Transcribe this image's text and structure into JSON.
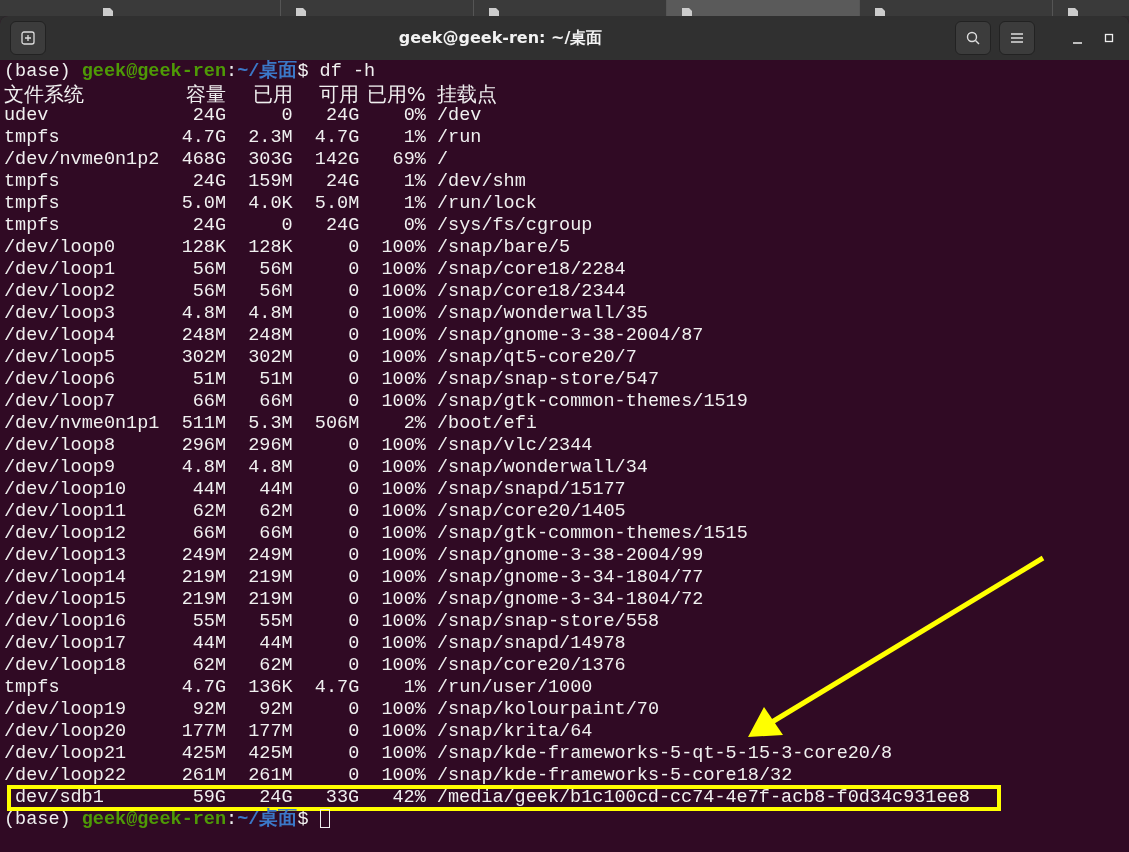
{
  "background_tabs": [
    {
      "selected": false
    },
    {
      "selected": false
    },
    {
      "selected": false
    },
    {
      "selected": true
    },
    {
      "selected": false
    },
    {
      "selected": false
    }
  ],
  "window": {
    "title": "geek@geek-ren: ~/桌面"
  },
  "terminal": {
    "prompt": {
      "env": "(base) ",
      "user_host": "geek@geek-ren",
      "sep": ":",
      "path": "~/桌面",
      "symbol": "$ ",
      "command": "df -h"
    },
    "header": [
      "文件系统",
      "容量",
      "已用",
      "可用",
      "已用%",
      "挂载点"
    ],
    "rows": [
      {
        "text": "udev             24G     0   24G    0% /dev",
        "highlighted": false
      },
      {
        "text": "tmpfs           4.7G  2.3M  4.7G    1% /run",
        "highlighted": false
      },
      {
        "text": "/dev/nvme0n1p2  468G  303G  142G   69% /",
        "highlighted": false
      },
      {
        "text": "tmpfs            24G  159M   24G    1% /dev/shm",
        "highlighted": false
      },
      {
        "text": "tmpfs           5.0M  4.0K  5.0M    1% /run/lock",
        "highlighted": false
      },
      {
        "text": "tmpfs            24G     0   24G    0% /sys/fs/cgroup",
        "highlighted": false
      },
      {
        "text": "/dev/loop0      128K  128K     0  100% /snap/bare/5",
        "highlighted": false
      },
      {
        "text": "/dev/loop1       56M   56M     0  100% /snap/core18/2284",
        "highlighted": false
      },
      {
        "text": "/dev/loop2       56M   56M     0  100% /snap/core18/2344",
        "highlighted": false
      },
      {
        "text": "/dev/loop3      4.8M  4.8M     0  100% /snap/wonderwall/35",
        "highlighted": false
      },
      {
        "text": "/dev/loop4      248M  248M     0  100% /snap/gnome-3-38-2004/87",
        "highlighted": false
      },
      {
        "text": "/dev/loop5      302M  302M     0  100% /snap/qt5-core20/7",
        "highlighted": false
      },
      {
        "text": "/dev/loop6       51M   51M     0  100% /snap/snap-store/547",
        "highlighted": false
      },
      {
        "text": "/dev/loop7       66M   66M     0  100% /snap/gtk-common-themes/1519",
        "highlighted": false
      },
      {
        "text": "/dev/nvme0n1p1  511M  5.3M  506M    2% /boot/efi",
        "highlighted": false
      },
      {
        "text": "/dev/loop8      296M  296M     0  100% /snap/vlc/2344",
        "highlighted": false
      },
      {
        "text": "/dev/loop9      4.8M  4.8M     0  100% /snap/wonderwall/34",
        "highlighted": false
      },
      {
        "text": "/dev/loop10      44M   44M     0  100% /snap/snapd/15177",
        "highlighted": false
      },
      {
        "text": "/dev/loop11      62M   62M     0  100% /snap/core20/1405",
        "highlighted": false
      },
      {
        "text": "/dev/loop12      66M   66M     0  100% /snap/gtk-common-themes/1515",
        "highlighted": false
      },
      {
        "text": "/dev/loop13     249M  249M     0  100% /snap/gnome-3-38-2004/99",
        "highlighted": false
      },
      {
        "text": "/dev/loop14     219M  219M     0  100% /snap/gnome-3-34-1804/77",
        "highlighted": false
      },
      {
        "text": "/dev/loop15     219M  219M     0  100% /snap/gnome-3-34-1804/72",
        "highlighted": false
      },
      {
        "text": "/dev/loop16      55M   55M     0  100% /snap/snap-store/558",
        "highlighted": false
      },
      {
        "text": "/dev/loop17      44M   44M     0  100% /snap/snapd/14978",
        "highlighted": false
      },
      {
        "text": "/dev/loop18      62M   62M     0  100% /snap/core20/1376",
        "highlighted": false
      },
      {
        "text": "tmpfs           4.7G  136K  4.7G    1% /run/user/1000",
        "highlighted": false
      },
      {
        "text": "/dev/loop19      92M   92M     0  100% /snap/kolourpaint/70",
        "highlighted": false
      },
      {
        "text": "/dev/loop20     177M  177M     0  100% /snap/krita/64",
        "highlighted": false
      },
      {
        "text": "/dev/loop21     425M  425M     0  100% /snap/kde-frameworks-5-qt-5-15-3-core20/8",
        "highlighted": false
      },
      {
        "text": "/dev/loop22     261M  261M     0  100% /snap/kde-frameworks-5-core18/32",
        "highlighted": false
      },
      {
        "text": "dev/sdb1        59G   24G   33G   42% /media/geek/b1c100cd-cc74-4e7f-acb8-f0d34c931ee8",
        "highlighted": true
      }
    ],
    "final_prompt": {
      "env": "(base) ",
      "user_host": "geek@geek-ren",
      "sep": ":",
      "path": "~/桌面",
      "symbol": "$ "
    }
  }
}
